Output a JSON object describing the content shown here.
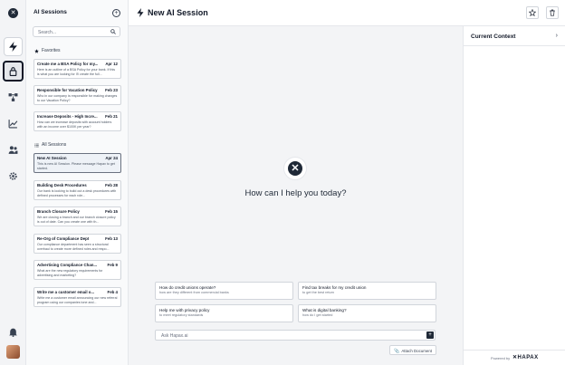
{
  "rail": {
    "logo": "✕",
    "items": [
      {
        "name": "bolt-icon"
      },
      {
        "name": "lock-icon"
      },
      {
        "name": "workflow-icon"
      },
      {
        "name": "chart-icon"
      },
      {
        "name": "users-icon"
      },
      {
        "name": "gear-icon"
      },
      {
        "name": "bell-icon"
      }
    ]
  },
  "sessions": {
    "title": "AI Sessions",
    "search_placeholder": "Search...",
    "favorites_label": "Favorites",
    "all_label": "All Sessions",
    "favorites": [
      {
        "title": "Create me a BSA Policy for my...",
        "date": "Apr 12",
        "preview": "Here is an outline of a BSA Policy for your bank. If this is what you are looking for I'll create the full..."
      },
      {
        "title": "Responsible for Vacation Policy",
        "date": "Feb 23",
        "preview": "Who in our company is responsible for making changes to our Vacation Policy?"
      },
      {
        "title": "Increase Deposits - High Incre...",
        "date": "Feb 21",
        "preview": "How can we increase deposits with account holders with an income over $100K per year?"
      }
    ],
    "all": [
      {
        "title": "New AI Session",
        "date": "Apr 24",
        "preview": "This is new AI Session. Please message Hapax to get started."
      },
      {
        "title": "Building Desk Procedures",
        "date": "Feb 28",
        "preview": "Our bank is looking to build out a desk procedures with defined processes for each role..."
      },
      {
        "title": "Branch Closure Policy",
        "date": "Feb 15",
        "preview": "We are closing a branch and our branch closure policy is out of date. Can you create one with th..."
      },
      {
        "title": "Re-Org of Compliance Dept",
        "date": "Feb 13",
        "preview": "Our compliance department has seen a structural overhaul to create more defined roles and respo..."
      },
      {
        "title": "Advertising Compliance Chan...",
        "date": "Feb 9",
        "preview": "What are the new regulatory requirements for advertising and marketing?"
      },
      {
        "title": "Write me a customer email o...",
        "date": "Feb 4",
        "preview": "Write me a customer email announcing our new referral program using our companies tone and..."
      }
    ]
  },
  "header": {
    "title": "New AI Session"
  },
  "main": {
    "greeting": "How can I help you today?",
    "suggestions": [
      {
        "title": "How do credit unions operate?",
        "sub": "how are they different from commercial banks"
      },
      {
        "title": "Find tax breaks for my credit union",
        "sub": "to get the best return"
      },
      {
        "title": "Help me with privacy policy",
        "sub": "to meet regulatory standards"
      },
      {
        "title": "What is digital banking?",
        "sub": "how do I get started"
      }
    ],
    "ask_placeholder": "Ask Hapax.ai",
    "attach_label": "Attach Document"
  },
  "context": {
    "title": "Current Context",
    "powered_by": "Powered by",
    "brand": "HAPAX"
  },
  "colors": {
    "accent": "#1f2937",
    "panel_bg": "#f9fafb",
    "main_bg": "#f3f4f6"
  }
}
